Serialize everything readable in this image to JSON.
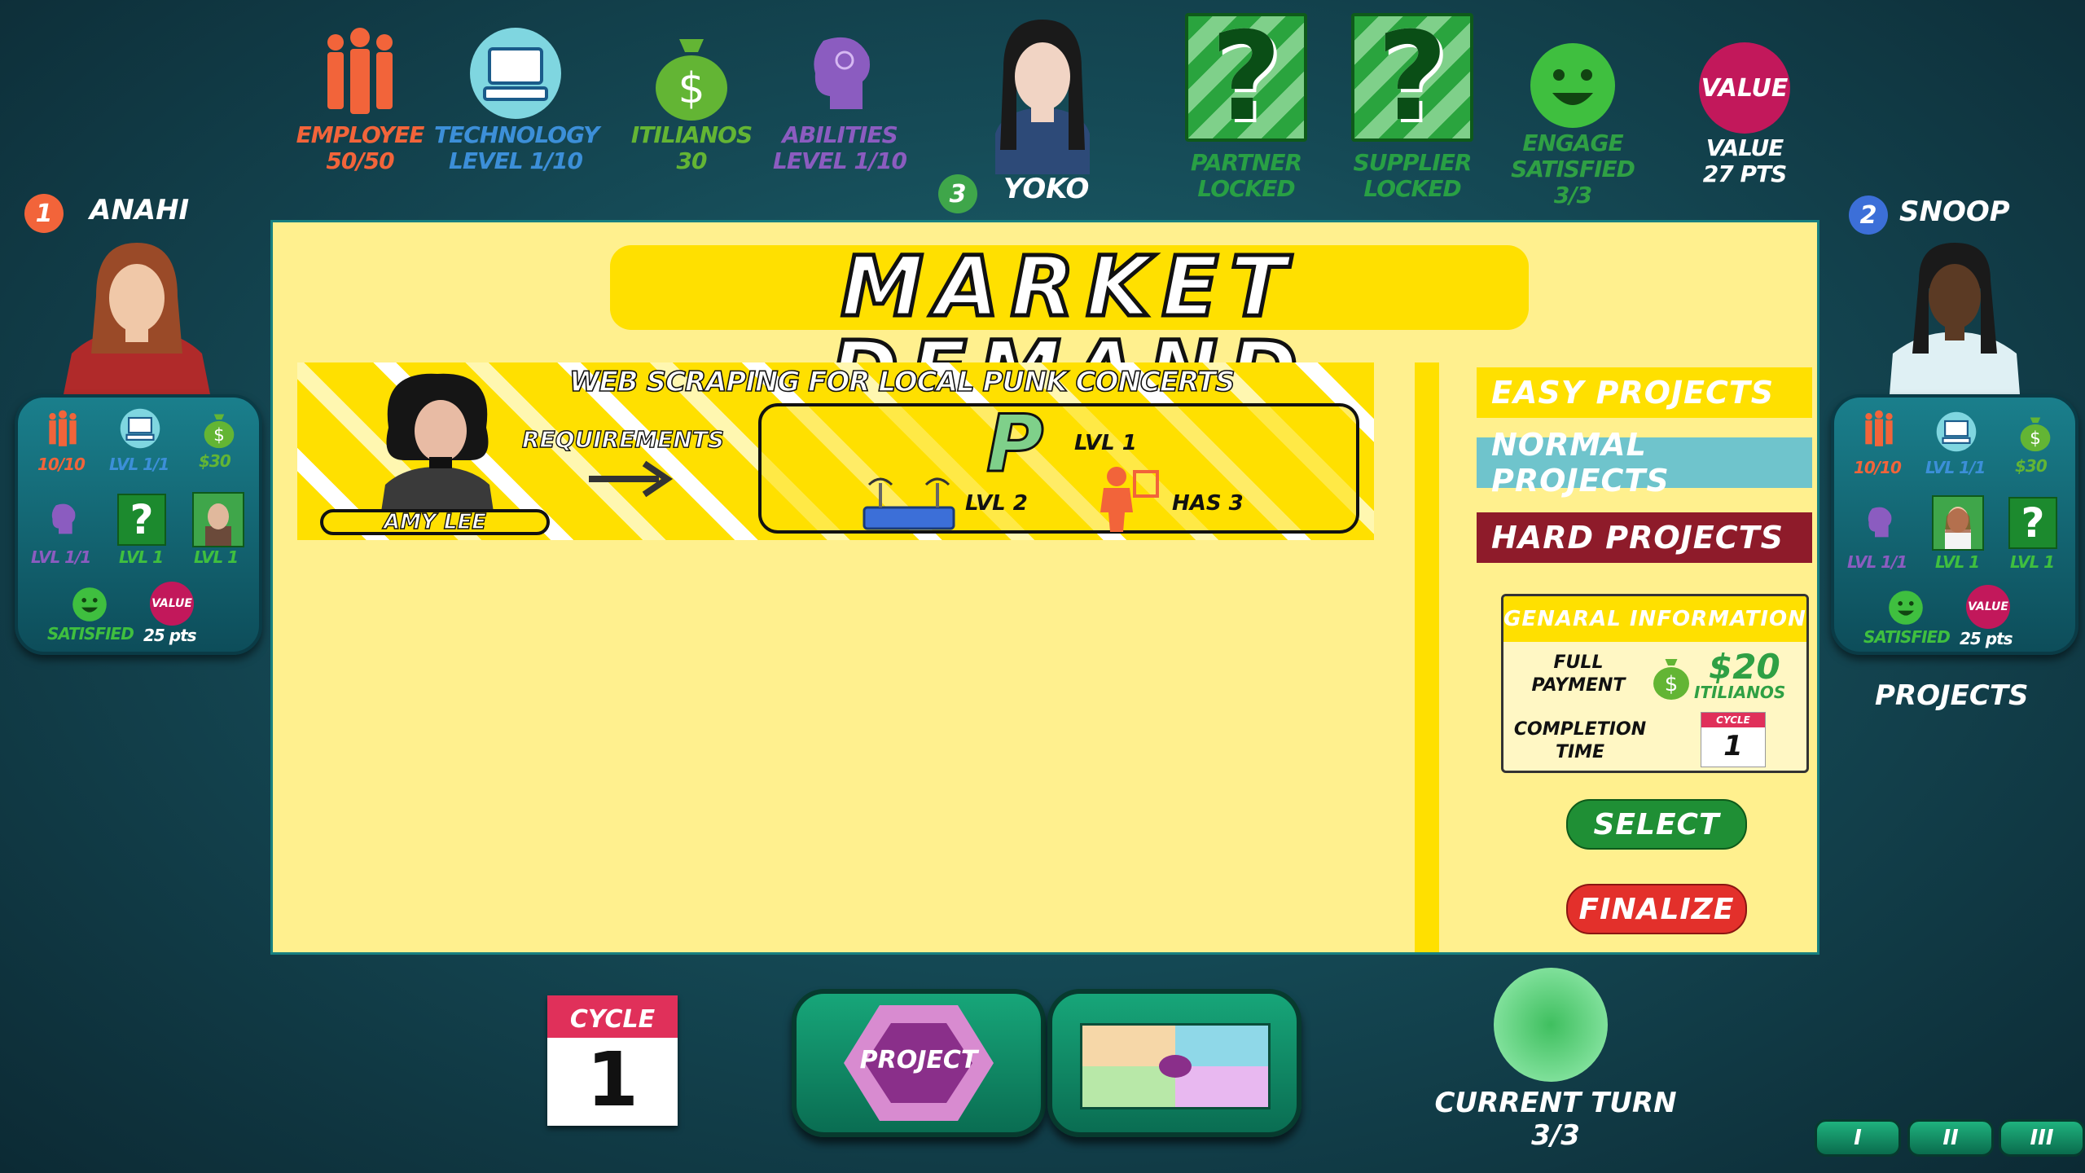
{
  "top_stats": {
    "employee": {
      "label": "EMPLOYEE",
      "value": "50/50"
    },
    "technology": {
      "label": "TECHNOLOGY",
      "value": "LEVEL  1/10"
    },
    "itilianos": {
      "label": "ITILIANOS",
      "value": "30"
    },
    "abilities": {
      "label": "ABILITIES",
      "value": "LEVEL  1/10"
    },
    "player": {
      "number": "3",
      "name": "YOKO"
    },
    "partner": {
      "label": "PARTNER",
      "value": "LOCKED"
    },
    "supplier": {
      "label": "SUPPLIER",
      "value": "LOCKED"
    },
    "engage": {
      "label": "ENGAGE",
      "status": "SATISFIED",
      "value": "3/3"
    },
    "value": {
      "icon_text": "VALUE",
      "label": "VALUE",
      "value": "27 PTS"
    }
  },
  "left_player": {
    "number": "1",
    "name": "ANAHI",
    "employee": "10/10",
    "tech": "LVL 1/1",
    "money": "$30",
    "abilities": "LVL 1/1",
    "partner": "LVL 1",
    "supplier": "LVL 1",
    "satisfied": "SATISFIED",
    "value_icon": "VALUE",
    "value": "25 pts"
  },
  "right_player": {
    "number": "2",
    "name": "SNOOP",
    "employee": "10/10",
    "tech": "LVL 1/1",
    "money": "$30",
    "abilities": "LVL 1/1",
    "partner": "LVL 1",
    "supplier": "LVL 1",
    "satisfied": "SATISFIED",
    "value_icon": "VALUE",
    "value": "25 pts",
    "projects_label": "PROJECTS"
  },
  "board": {
    "title": "MARKET DEMAND",
    "project": {
      "title": "WEB SCRAPING FOR LOCAL PUNK CONCERTS",
      "client": "AMY LEE",
      "requirements_label": "REQUIREMENTS",
      "req_abilities_letter": "P",
      "req_abilities": "LVL 1",
      "req_tech": "LVL 2",
      "req_employees": "HAS 3"
    },
    "categories": [
      "EASY PROJECTS",
      "NORMAL PROJECTS",
      "HARD PROJECTS"
    ],
    "info": {
      "header": "GENARAL INFORMATION",
      "payment_label": "FULL PAYMENT",
      "payment_value": "$20",
      "payment_unit": "ITILIANOS",
      "completion_label": "COMPLETION TIME",
      "cycle_label": "CYCLE",
      "cycle_value": "1"
    },
    "select_label": "SELECT",
    "finalize_label": "FINALIZE"
  },
  "bottom": {
    "cycle_label": "CYCLE",
    "cycle_value": "1",
    "project_label": "PROJECT",
    "turn_label": "CURRENT TURN",
    "turn_value": "3/3",
    "round_buttons": [
      "I",
      "II",
      "III"
    ]
  },
  "colors": {
    "employee": "#f2643a",
    "technology": "#3c8fd8",
    "itilianos": "#63b534",
    "abilities": "#8b5cc0",
    "partner": "#1c8a2e",
    "value": "#c2185b",
    "board": "#fff08e",
    "easy": "#ffe000",
    "normal": "#6fc4cc",
    "hard": "#8e1b2a",
    "select": "#1f8f35",
    "finalize": "#e3302b"
  }
}
